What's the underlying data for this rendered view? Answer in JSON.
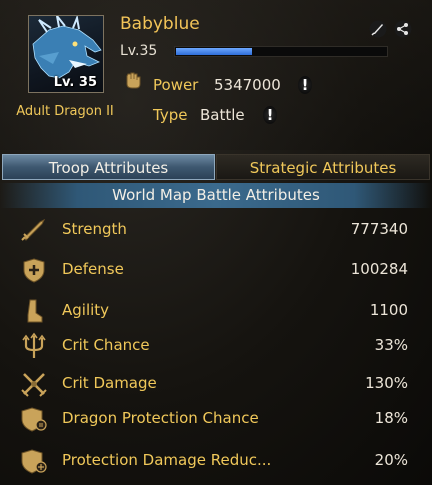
{
  "dragon": {
    "portrait_level": "Lv. 35",
    "type_name": "Adult Dragon II",
    "name": "Babyblue",
    "level_label": "Lv.35",
    "xp_progress": 0.36,
    "power_label": "Power",
    "power_value": "5347000",
    "type_label": "Type",
    "type_value": "Battle",
    "info_mark": "!"
  },
  "header_icons": [
    "feather-pen-icon",
    "share-icon"
  ],
  "tabs": [
    {
      "label": "Troop Attributes",
      "active": true
    },
    {
      "label": "Strategic Attributes",
      "active": false
    }
  ],
  "section_title": "World Map Battle Attributes",
  "attributes": [
    {
      "icon": "sword-icon",
      "label": "Strength",
      "value": "777340"
    },
    {
      "icon": "shield-plus-icon",
      "label": "Defense",
      "value": "100284"
    },
    {
      "icon": "boot-icon",
      "label": "Agility",
      "value": "1100"
    },
    {
      "icon": "trident-icon",
      "label": "Crit Chance",
      "value": "33%"
    },
    {
      "icon": "crossed-swords-icon",
      "label": "Crit Damage",
      "value": "130%"
    },
    {
      "icon": "dragon-shield-icon",
      "label": "Dragon Protection Chance",
      "value": "18%"
    },
    {
      "icon": "protection-shield-icon",
      "label": "Protection Damage Reduc...",
      "value": "20%"
    }
  ],
  "colors": {
    "accent_gold": "#f0c85a",
    "tab_active": "#4e6b85",
    "xp_blue": "#3b7be6"
  }
}
